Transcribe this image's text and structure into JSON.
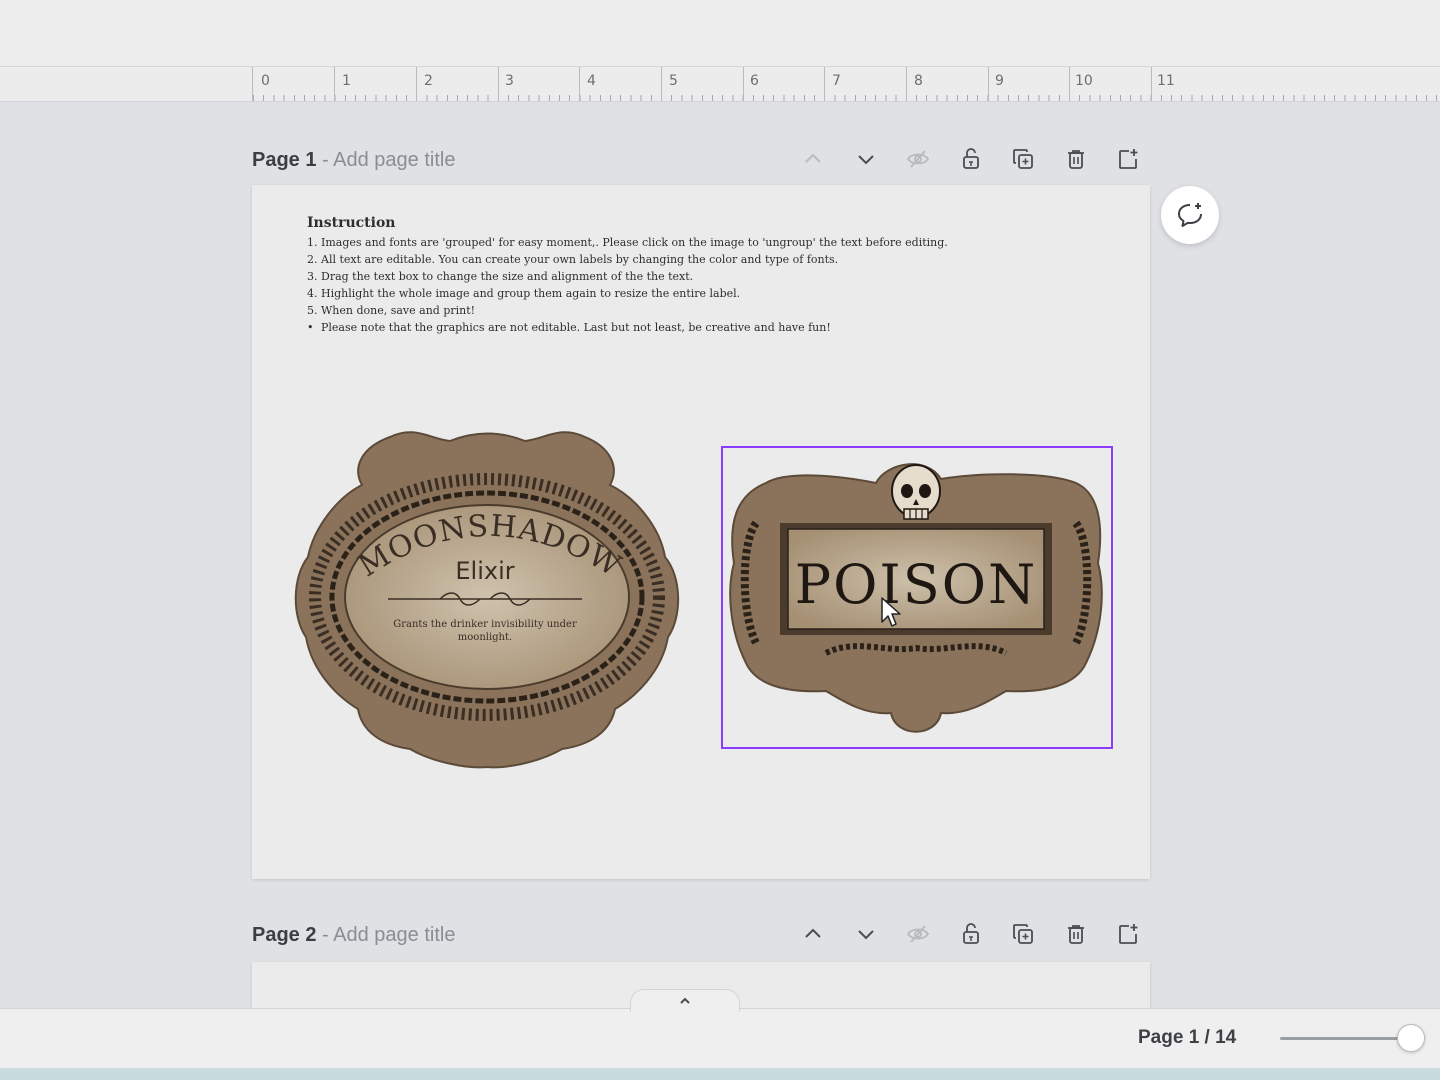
{
  "ruler": {
    "numbers": [
      "0",
      "1",
      "2",
      "3",
      "4",
      "5",
      "6",
      "7",
      "8",
      "9",
      "10",
      "11"
    ]
  },
  "pages": [
    {
      "number_label": "Page 1",
      "separator": " - ",
      "title_placeholder": "Add page title"
    },
    {
      "number_label": "Page 2",
      "separator": " - ",
      "title_placeholder": "Add page title"
    }
  ],
  "header_icons": [
    "chevron-up-icon",
    "chevron-down-icon",
    "eye-hidden-icon",
    "lock-open-icon",
    "duplicate-icon",
    "trash-icon",
    "add-page-icon"
  ],
  "instructions": {
    "title": "Instruction",
    "items": [
      {
        "marker": "1.",
        "text": "Images and fonts are 'grouped' for easy moment,. Please click on the image to 'ungroup' the text before editing."
      },
      {
        "marker": "2.",
        "text": "All text are editable. You can create your own labels by changing the color and type of fonts."
      },
      {
        "marker": "3.",
        "text": "Drag the text box to change the size and alignment of the the text."
      },
      {
        "marker": "4.",
        "text": "Highlight the whole image and group them again to resize the entire label."
      },
      {
        "marker": "5.",
        "text": "When done, save and print!"
      },
      {
        "marker": "•",
        "text": "Please note that the graphics are not editable. Last but not least, be creative and have fun!"
      }
    ]
  },
  "labels": {
    "moonshadow": {
      "title": "MOONSHADOW",
      "subtitle": "Elixir",
      "description_line1": "Grants the drinker invisibility under",
      "description_line2": "moonlight."
    },
    "poison": {
      "title": "POISON"
    }
  },
  "footer": {
    "collapse_icon": "chevron-up-icon",
    "page_indicator": "Page 1 / 14"
  },
  "colors": {
    "selection": "#8b3dff",
    "label_paper": "#b8a68a",
    "label_ink": "#3a2e24"
  }
}
